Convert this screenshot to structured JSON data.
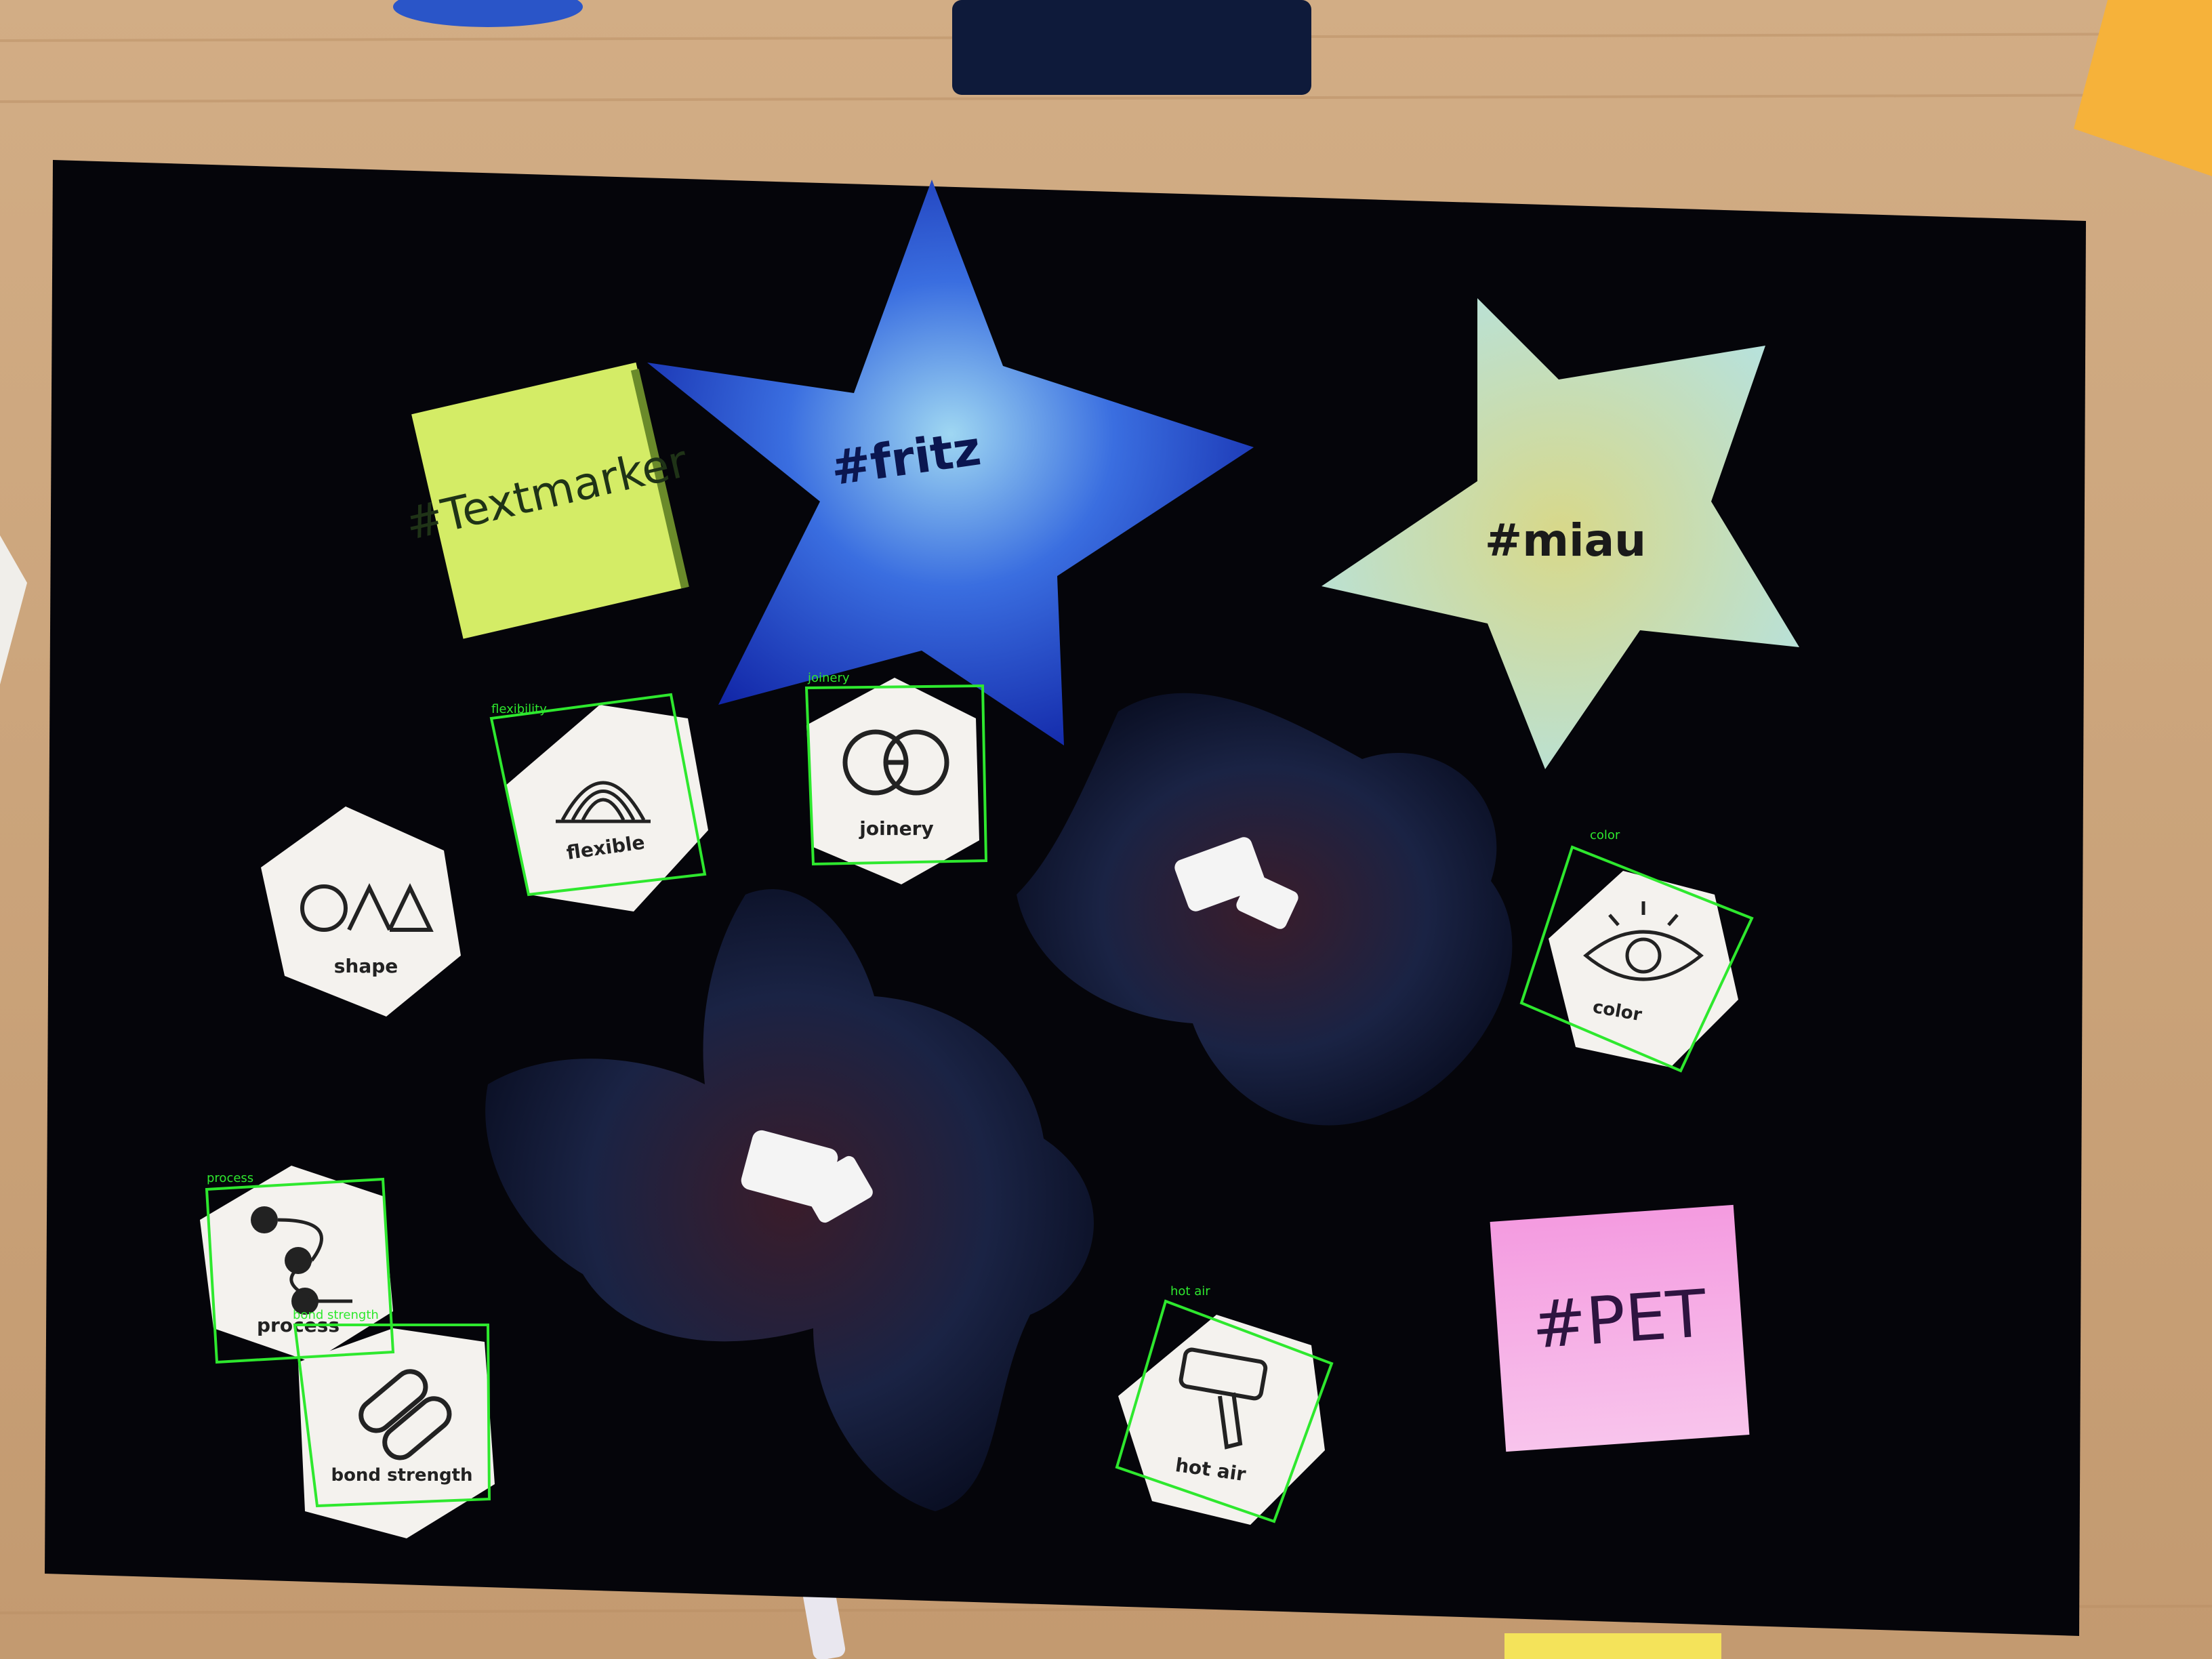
{
  "colors": {
    "table": "#c9a27a",
    "board": "#05050a",
    "detection_box": "#2ee82e",
    "sticky_yellow_green": "#d8ef6a",
    "sticky_pink": "#f6a8e0",
    "star_blue": "#1f3fc0",
    "star_pale": "#cfe8d4",
    "tile": "#f4f2ee"
  },
  "notes": {
    "textmarker": "#Textmarker",
    "pet": "#PET"
  },
  "stars": {
    "fritz": "#fritz",
    "miau": "#miau"
  },
  "tiles": [
    {
      "label": "shape",
      "icon": "shape-icon"
    },
    {
      "label": "flexible",
      "icon": "flexibility-icon"
    },
    {
      "label": "joinery",
      "icon": "joinery-icon"
    },
    {
      "label": "color",
      "icon": "eye-icon"
    },
    {
      "label": "process",
      "icon": "process-icon"
    },
    {
      "label": "bond strength",
      "icon": "chain-link-icon"
    },
    {
      "label": "hot air",
      "icon": "heat-gun-icon"
    }
  ],
  "detections": [
    {
      "label": "flexibility"
    },
    {
      "label": "joinery"
    },
    {
      "label": "color"
    },
    {
      "label": "process"
    },
    {
      "label": "bond strength"
    },
    {
      "label": "hot air"
    }
  ]
}
